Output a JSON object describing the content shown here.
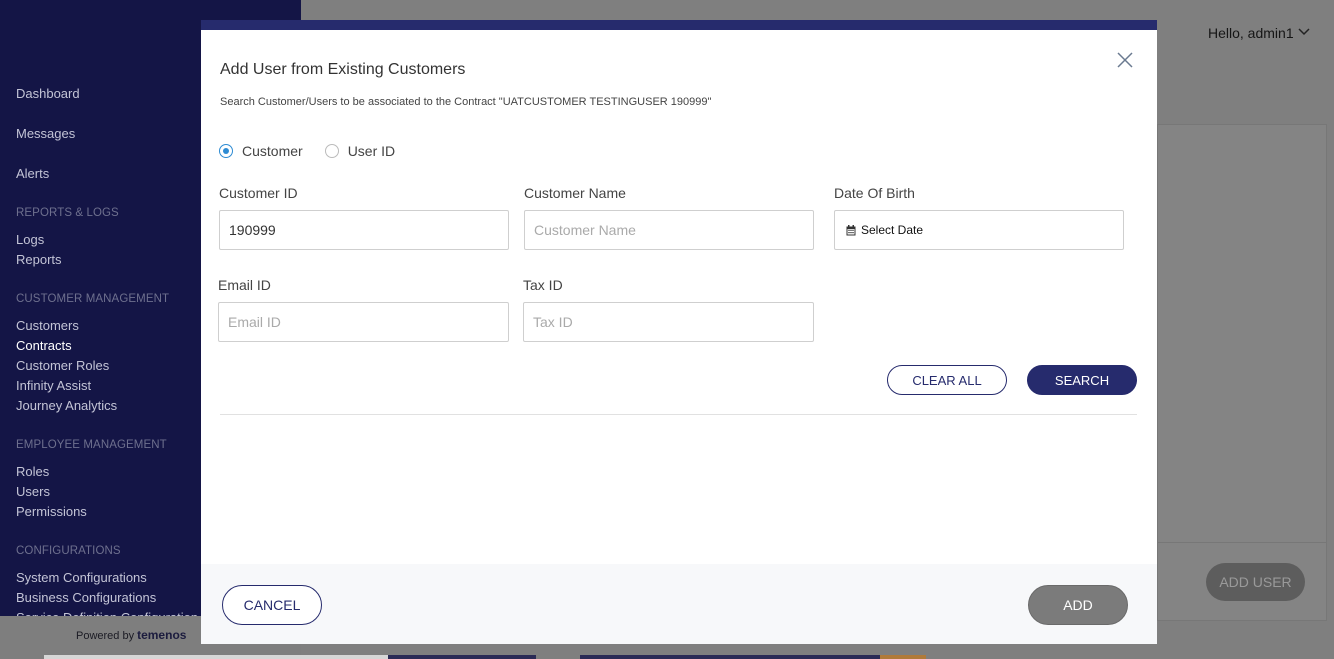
{
  "sidebar": {
    "items": [
      {
        "label": "Dashboard"
      },
      {
        "label": "Messages"
      },
      {
        "label": "Alerts"
      }
    ],
    "sections": [
      {
        "header": "REPORTS & LOGS",
        "items": [
          {
            "label": "Logs"
          },
          {
            "label": "Reports"
          }
        ]
      },
      {
        "header": "CUSTOMER MANAGEMENT",
        "items": [
          {
            "label": "Customers"
          },
          {
            "label": "Contracts"
          },
          {
            "label": "Customer Roles"
          },
          {
            "label": "Infinity Assist"
          },
          {
            "label": "Journey Analytics"
          }
        ]
      },
      {
        "header": "EMPLOYEE MANAGEMENT",
        "items": [
          {
            "label": "Roles"
          },
          {
            "label": "Users"
          },
          {
            "label": "Permissions"
          }
        ]
      },
      {
        "header": "CONFIGURATIONS",
        "items": [
          {
            "label": "System Configurations"
          },
          {
            "label": "Business Configurations"
          },
          {
            "label": "Service Definition Configuration"
          }
        ]
      }
    ],
    "powered_by": "Powered by",
    "brand": "temenos"
  },
  "header": {
    "greeting": "Hello, admin1"
  },
  "background": {
    "add_user_label": "ADD USER"
  },
  "modal": {
    "title": "Add User from Existing Customers",
    "subtitle": "Search Customer/Users to be associated to the Contract \"UATCUSTOMER TESTINGUSER 190999\"",
    "radios": [
      {
        "label": "Customer",
        "checked": true
      },
      {
        "label": "User ID",
        "checked": false
      }
    ],
    "fields": {
      "customer_id": {
        "label": "Customer ID",
        "value": "190999",
        "placeholder": "Customer ID"
      },
      "customer_name": {
        "label": "Customer Name",
        "value": "",
        "placeholder": "Customer Name"
      },
      "dob": {
        "label": "Date Of Birth",
        "value": "Select Date"
      },
      "email_id": {
        "label": "Email ID",
        "value": "",
        "placeholder": "Email ID"
      },
      "tax_id": {
        "label": "Tax ID",
        "value": "",
        "placeholder": "Tax ID"
      }
    },
    "clear_all_label": "CLEAR ALL",
    "search_label": "SEARCH",
    "cancel_label": "CANCEL",
    "add_label": "ADD"
  },
  "colors": {
    "primary": "#262b6d",
    "sidebar": "#141546",
    "radio_checked": "#2d8bd3",
    "overlay": "#7f7f7f"
  },
  "icons": {
    "close": "close-icon",
    "calendar": "calendar-icon",
    "chevron": "chevron-down-icon"
  }
}
